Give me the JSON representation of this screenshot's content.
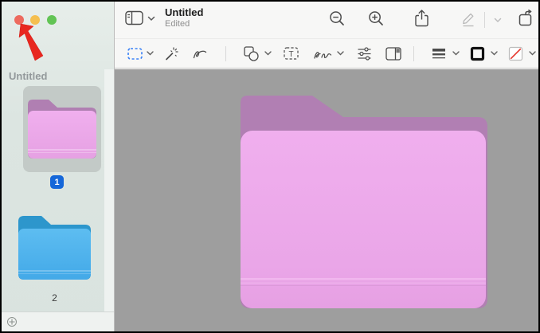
{
  "window": {
    "title": "Untitled",
    "subtitle": "Edited"
  },
  "traffic_lights": {
    "close": "#ed6a5e",
    "minimize": "#f5bf4f",
    "zoom": "#62c454"
  },
  "annotation": {
    "type": "red-arrow",
    "color": "#e8271f",
    "points_at": "close-button"
  },
  "sidebar": {
    "header": "Untitled",
    "pages": [
      {
        "label": "1",
        "selected": true,
        "folder_front": "#eeabea",
        "folder_back": "#b07fb2",
        "badge_color": "#1567d9"
      },
      {
        "label": "2",
        "selected": false,
        "folder_front": "#54b7ed",
        "folder_back": "#2d96cc"
      }
    ],
    "add_button": "+"
  },
  "titlebar_icons": [
    "sidebar-toggle",
    "chevron-down",
    "zoom-out",
    "zoom-in",
    "share",
    "markup-pencil",
    "chevron-down",
    "rotate-page"
  ],
  "markup_icons": [
    "rectangular-selection",
    "instant-alpha",
    "sketch",
    "shapes",
    "text-box",
    "signature",
    "adjust-color",
    "crop-panel",
    "shape-style",
    "border-color",
    "fill-color"
  ],
  "colors": {
    "canvas_background": "#9e9e9e",
    "selection_tool_blue": "#3b82f7",
    "no_fill_slash_red": "#e5352b",
    "canvas_folder_front": "#eeadec",
    "canvas_folder_back": "#b17fb3"
  }
}
